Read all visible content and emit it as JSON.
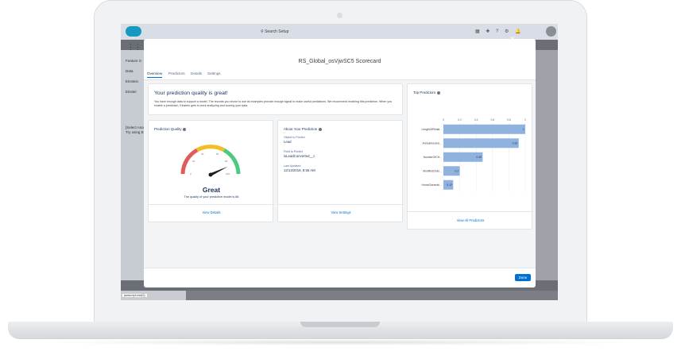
{
  "app": {
    "search_placeholder": "Search Setup",
    "tree_item_1": "Feature S",
    "tree_item_2": "Data",
    "tree_item_3": "Einstein",
    "tree_item_4": "Einstei",
    "left_note_1": "[Select Anal",
    "left_note_2": "Try using Ei",
    "bottom_tag": "javascript:void(0);"
  },
  "modal": {
    "title": "RS_Global_osVjwSC5 Scorecard",
    "tabs": [
      {
        "label": "Overview"
      },
      {
        "label": "Predictors"
      },
      {
        "label": "Details"
      },
      {
        "label": "Settings"
      }
    ],
    "headline": "Your prediction quality is great!",
    "description": "You have enough data to support a model. The records you chose to use as examples provide enough signal to make useful predictions. We recommend enabling this prediction. When you enable a prediction, Einstein gets to work analyzing and scoring your data.",
    "done_label": "Done"
  },
  "quality_card": {
    "title": "Prediction Quality",
    "rating": "Great",
    "caption": "The quality of your predictive model is 86",
    "score": 86,
    "gauge_ticks": [
      "0",
      "20",
      "40",
      "60",
      "80",
      "100"
    ],
    "link": "View Details"
  },
  "about_card": {
    "title": "About Your Prediction",
    "object_label": "Object to Predict",
    "object_value": "Lead",
    "field_label": "Field to Predict",
    "field_value": "isLeadConverted__c",
    "updated_label": "Last Updated",
    "updated_value": "12/13/2019, 8:55 AM",
    "link": "View Settings"
  },
  "predictors_card": {
    "title": "Top Predictors",
    "link": "View All Predictors"
  },
  "colors": {
    "brand_blue": "#0070d2",
    "bar_blue": "#8fb3de",
    "gauge_green": "#4bca81",
    "gauge_red": "#e25b5b",
    "gauge_yellow": "#f4bc25"
  },
  "chart_data": {
    "type": "bar",
    "orientation": "horizontal",
    "categories": [
      "LengthOfRelati...",
      "AnnualIncome...",
      "NumberOfCH...",
      "ModifiedChan...",
      "HomeOwnersh..."
    ],
    "values": [
      1,
      0.92,
      0.48,
      0.2,
      0.12
    ],
    "value_labels": [
      "1",
      "0.92",
      "0.48",
      "0.2",
      "0.12"
    ],
    "x_ticks": [
      "0",
      "0.2",
      "0.4",
      "0.6",
      "0.8",
      "1"
    ],
    "xlim": [
      0,
      1
    ],
    "grid": true,
    "title": "Top Predictors"
  }
}
